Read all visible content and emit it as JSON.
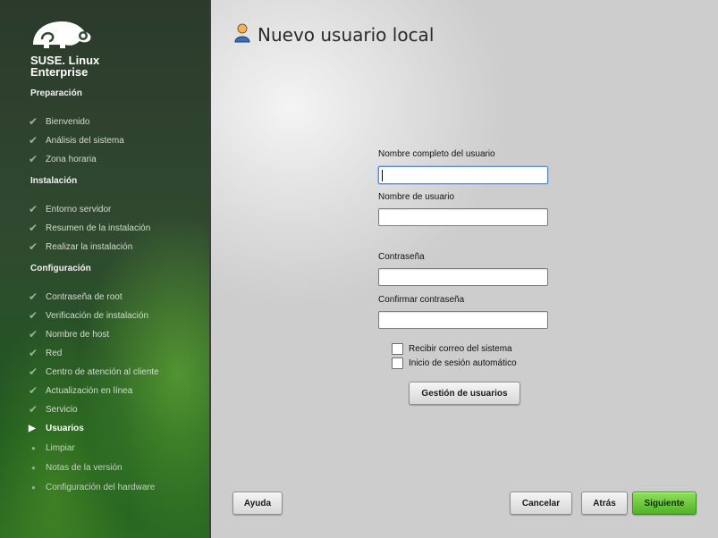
{
  "brand": {
    "name_line1": "SUSE. Linux",
    "name_line2": "Enterprise"
  },
  "colors": {
    "accent": "#5fb734",
    "sidebar_bg": "#2f4a2f"
  },
  "sidebar": {
    "sections": [
      {
        "title": "Preparación",
        "steps": [
          {
            "label": "Bienvenido",
            "state": "done"
          },
          {
            "label": "Análisis del sistema",
            "state": "done"
          },
          {
            "label": "Zona horaria",
            "state": "done"
          }
        ]
      },
      {
        "title": "Instalación",
        "steps": [
          {
            "label": "Entorno servidor",
            "state": "done"
          },
          {
            "label": "Resumen de la instalación",
            "state": "done"
          },
          {
            "label": "Realizar la instalación",
            "state": "done"
          }
        ]
      },
      {
        "title": "Configuración",
        "steps": [
          {
            "label": "Contraseña de root",
            "state": "done"
          },
          {
            "label": "Verificación de instalación",
            "state": "done"
          },
          {
            "label": "Nombre de host",
            "state": "done"
          },
          {
            "label": "Red",
            "state": "done"
          },
          {
            "label": "Centro de atención al cliente",
            "state": "done"
          },
          {
            "label": "Actualización en línea",
            "state": "done"
          },
          {
            "label": "Servicio",
            "state": "done"
          },
          {
            "label": "Usuarios",
            "state": "current"
          },
          {
            "label": "Limpiar",
            "state": "pending"
          },
          {
            "label": "Notas de la versión",
            "state": "pending"
          },
          {
            "label": "Configuración del hardware",
            "state": "pending"
          }
        ]
      }
    ]
  },
  "main": {
    "title": "Nuevo usuario local",
    "title_icon": "user-icon",
    "fields": {
      "full_name": {
        "label": "Nombre completo del usuario",
        "value": ""
      },
      "username": {
        "label": "Nombre de usuario",
        "value": ""
      },
      "password": {
        "label": "Contraseña",
        "value": ""
      },
      "confirm_password": {
        "label": "Confirmar contraseña",
        "value": ""
      }
    },
    "checkboxes": {
      "receive_mail": {
        "label": "Recibir correo del sistema",
        "checked": false
      },
      "auto_login": {
        "label": "Inicio de sesión automático",
        "checked": false
      }
    },
    "user_management_button": "Gestión de usuarios"
  },
  "footer": {
    "help": "Ayuda",
    "cancel": "Cancelar",
    "back": "Atrás",
    "next": "Siguiente"
  }
}
